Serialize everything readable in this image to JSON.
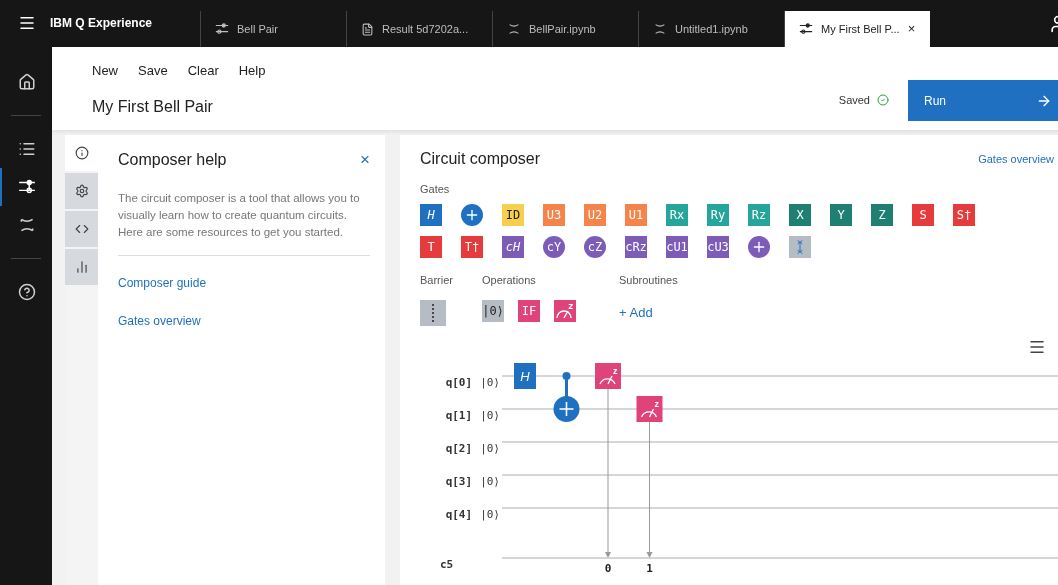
{
  "app": {
    "title": "IBM Q Experience"
  },
  "tabs": [
    {
      "label": "Bell Pair",
      "kind": "circuit",
      "selected": false
    },
    {
      "label": "Result 5d7202a...",
      "kind": "result",
      "selected": false
    },
    {
      "label": "BellPair.ipynb",
      "kind": "notebook",
      "selected": false
    },
    {
      "label": "Untitled1.ipynb",
      "kind": "notebook",
      "selected": false
    },
    {
      "label": "My First Bell P...",
      "kind": "circuit",
      "selected": true,
      "close": "×"
    }
  ],
  "sidebar": [
    {
      "kind": "home",
      "selected": false
    },
    {
      "kind": "list",
      "selected": false
    },
    {
      "kind": "circuit",
      "selected": true
    },
    {
      "kind": "bracket",
      "selected": false
    },
    {
      "kind": "help",
      "selected": false
    }
  ],
  "menu": [
    "New",
    "Save",
    "Clear",
    "Help"
  ],
  "document": {
    "title": "My First Bell Pair",
    "status": "Saved",
    "run": "Run"
  },
  "panel_tabs": [
    {
      "kind": "info",
      "selected": true
    },
    {
      "kind": "settings",
      "selected": false
    },
    {
      "kind": "code",
      "selected": false
    },
    {
      "kind": "chart",
      "selected": false
    }
  ],
  "help": {
    "title": "Composer help",
    "close": "×",
    "text": "The circuit composer is a tool that allows you to visually learn how to create quantum circuits. Here are some resources to get you started.",
    "links": [
      "Composer guide",
      "Gates overview"
    ]
  },
  "composer": {
    "title": "Circuit composer",
    "link": "Gates overview",
    "gates_label": "Gates",
    "gates": [
      {
        "kind": "box",
        "label": "H",
        "color": "#1f70c1",
        "italic": true
      },
      {
        "kind": "plus",
        "color": "#1f70c1"
      },
      {
        "kind": "box",
        "label": "ID",
        "color": "#f6d04d",
        "dark": true
      },
      {
        "kind": "box",
        "label": "U3",
        "color": "#f4844a"
      },
      {
        "kind": "box",
        "label": "U2",
        "color": "#f4844a"
      },
      {
        "kind": "box",
        "label": "U1",
        "color": "#f4844a"
      },
      {
        "kind": "box",
        "label": "Rx",
        "color": "#26a69a"
      },
      {
        "kind": "box",
        "label": "Ry",
        "color": "#26a69a"
      },
      {
        "kind": "box",
        "label": "Rz",
        "color": "#26a69a"
      },
      {
        "kind": "box",
        "label": "X",
        "color": "#1f7f73"
      },
      {
        "kind": "box",
        "label": "Y",
        "color": "#1f7f73"
      },
      {
        "kind": "box",
        "label": "Z",
        "color": "#1f7f73"
      },
      {
        "kind": "box",
        "label": "S",
        "color": "#e53b3d"
      },
      {
        "kind": "box",
        "label": "S†",
        "color": "#e53b3d"
      },
      {
        "kind": "box",
        "label": "T",
        "color": "#e53b3d"
      },
      {
        "kind": "box",
        "label": "T†",
        "color": "#e53b3d"
      },
      {
        "kind": "box",
        "label": "cH",
        "color": "#7c5cb7",
        "italic": true
      },
      {
        "kind": "circle",
        "label": "cY",
        "color": "#7c5cb7"
      },
      {
        "kind": "circle",
        "label": "cZ",
        "color": "#7c5cb7"
      },
      {
        "kind": "box",
        "label": "cRz",
        "color": "#7c5cb7"
      },
      {
        "kind": "box",
        "label": "cU1",
        "color": "#7c5cb7"
      },
      {
        "kind": "box",
        "label": "cU3",
        "color": "#7c5cb7"
      },
      {
        "kind": "plus",
        "color": "#7c5cb7"
      },
      {
        "kind": "swap",
        "color": "#b5bcc4"
      }
    ],
    "barrier_label": "Barrier",
    "operations_label": "Operations",
    "subroutines_label": "Subroutines",
    "operations": [
      {
        "kind": "box",
        "label": "|0⟩",
        "color": "#b5bcc4",
        "dark": true
      },
      {
        "kind": "box",
        "label": "IF",
        "color": "#e0427a"
      },
      {
        "kind": "measure",
        "color": "#e0427a",
        "basis": "z"
      }
    ],
    "add": "+ Add"
  },
  "circuit": {
    "qubits": [
      {
        "label": "q[0]",
        "init": "|0⟩"
      },
      {
        "label": "q[1]",
        "init": "|0⟩"
      },
      {
        "label": "q[2]",
        "init": "|0⟩"
      },
      {
        "label": "q[3]",
        "init": "|0⟩"
      },
      {
        "label": "q[4]",
        "init": "|0⟩"
      }
    ],
    "classical": "c5",
    "steps": [
      {
        "wires": [
          {
            "kind": "h",
            "label": "H"
          },
          {
            "kind": "none"
          },
          {
            "kind": "none"
          },
          {
            "kind": "none"
          },
          {
            "kind": "none"
          }
        ]
      },
      {
        "wires": [
          {
            "kind": "control"
          },
          {
            "kind": "target"
          },
          {
            "kind": "none"
          },
          {
            "kind": "none"
          },
          {
            "kind": "none"
          }
        ]
      },
      {
        "wires": [
          {
            "kind": "measure",
            "basis": "z",
            "bit": "0"
          },
          {
            "kind": "none"
          },
          {
            "kind": "none"
          },
          {
            "kind": "none"
          },
          {
            "kind": "none"
          }
        ]
      },
      {
        "wires": [
          {
            "kind": "none"
          },
          {
            "kind": "measure",
            "basis": "z",
            "bit": "1"
          },
          {
            "kind": "none"
          },
          {
            "kind": "none"
          },
          {
            "kind": "none"
          }
        ]
      }
    ]
  }
}
